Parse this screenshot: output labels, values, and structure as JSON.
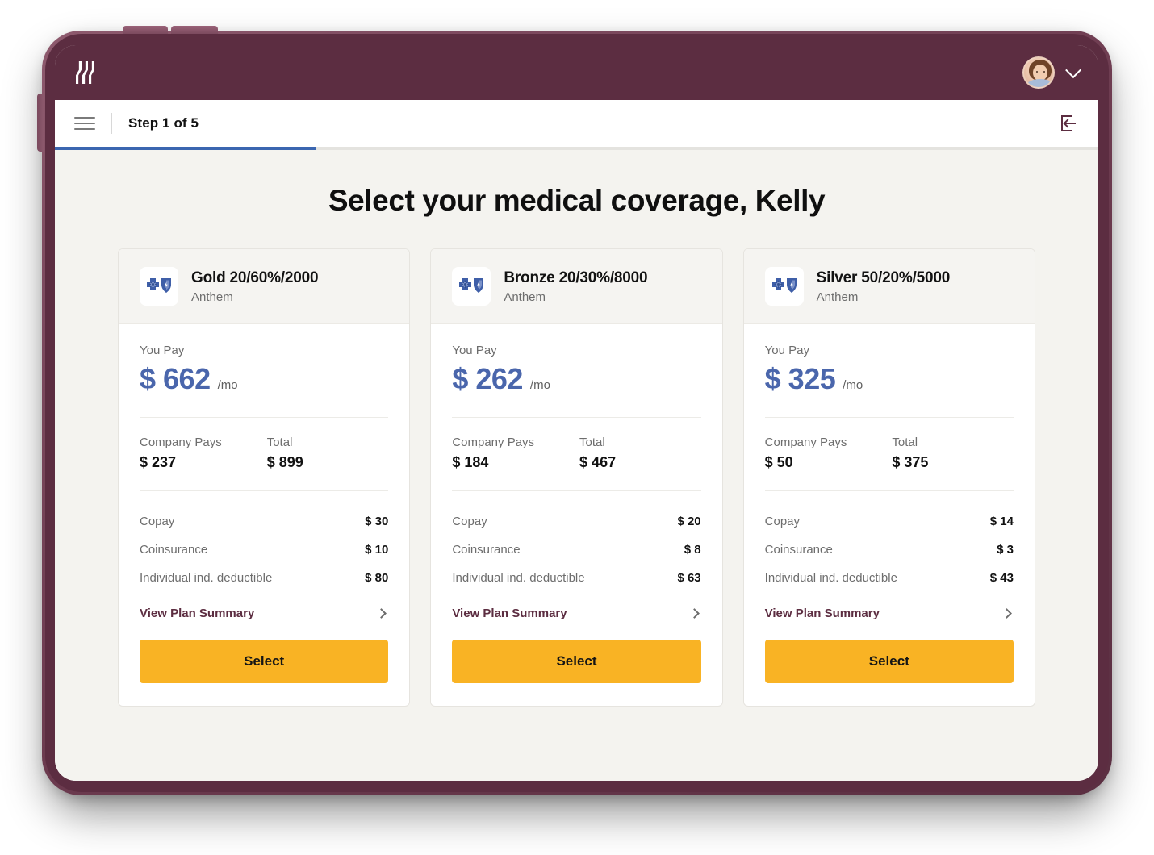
{
  "app": {
    "logo_icon": "three-wave-strokes-logo",
    "avatar_icon": "user-avatar-photo",
    "account_chevron_icon": "chevron-down-icon",
    "brand_color": "#5c2d41"
  },
  "step_bar": {
    "menu_icon": "hamburger-menu-icon",
    "step_label": "Step 1 of 5",
    "exit_icon": "exit-logout-icon",
    "progress_percent": 25,
    "progress_color": "#3b66b0"
  },
  "main": {
    "title": "Select your medical coverage, Kelly",
    "you_pay_label": "You Pay",
    "per_month_suffix": "/mo",
    "company_pays_label": "Company Pays",
    "total_label": "Total",
    "summary_link_label": "View Plan Summary",
    "select_button_label": "Select",
    "currency_symbol": "$",
    "accent_price_color": "#4a66ac",
    "select_button_color": "#f9b324",
    "plans": [
      {
        "name": "Gold 20/60%/2000",
        "carrier": "Anthem",
        "carrier_logo_icon": "anthem-blue-cross-blue-shield-logo",
        "you_pay": "$ 662",
        "company_pays": "$ 237",
        "total": "$ 899",
        "benefits": [
          {
            "label": "Copay",
            "value": "$ 30"
          },
          {
            "label": "Coinsurance",
            "value": "$ 10"
          },
          {
            "label": "Individual ind. deductible",
            "value": "$ 80"
          }
        ]
      },
      {
        "name": "Bronze 20/30%/8000",
        "carrier": "Anthem",
        "carrier_logo_icon": "anthem-blue-cross-blue-shield-logo",
        "you_pay": "$ 262",
        "company_pays": "$ 184",
        "total": "$ 467",
        "benefits": [
          {
            "label": "Copay",
            "value": "$ 20"
          },
          {
            "label": "Coinsurance",
            "value": "$ 8"
          },
          {
            "label": "Individual ind. deductible",
            "value": "$ 63"
          }
        ]
      },
      {
        "name": "Silver 50/20%/5000",
        "carrier": "Anthem",
        "carrier_logo_icon": "anthem-blue-cross-blue-shield-logo",
        "you_pay": "$ 325",
        "company_pays": "$ 50",
        "total": "$ 375",
        "benefits": [
          {
            "label": "Copay",
            "value": "$ 14"
          },
          {
            "label": "Coinsurance",
            "value": "$ 3"
          },
          {
            "label": "Individual ind. deductible",
            "value": "$ 43"
          }
        ]
      }
    ]
  }
}
